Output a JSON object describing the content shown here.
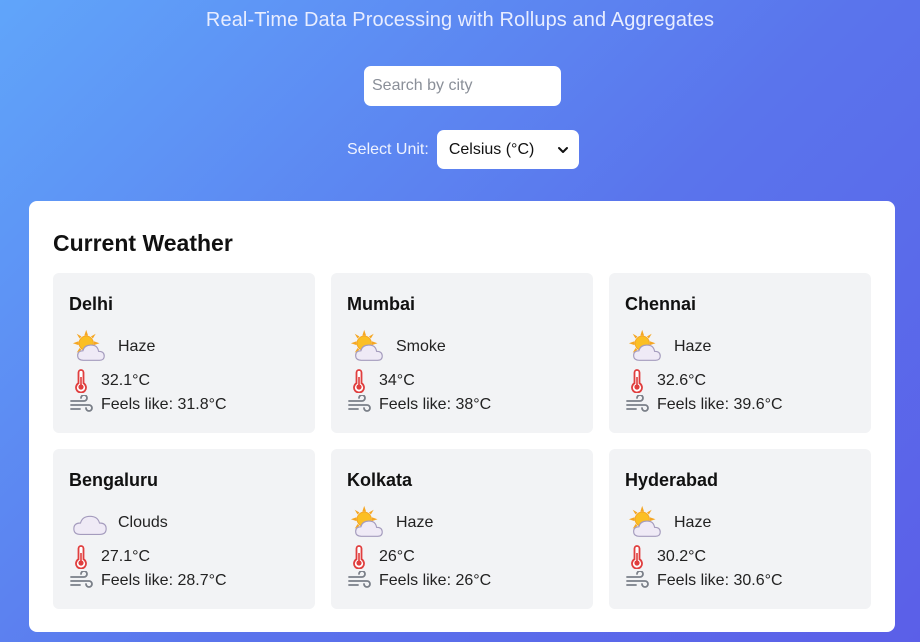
{
  "header": {
    "title": "Real-Time Data Processing with Rollups and Aggregates"
  },
  "search": {
    "placeholder": "Search by city",
    "value": ""
  },
  "unit": {
    "label": "Select Unit:",
    "selected": "Celsius (°C)"
  },
  "panel": {
    "title": "Current Weather"
  },
  "cities": [
    {
      "name": "Delhi",
      "condition": "Haze",
      "icon": "sun-cloud-icon",
      "temp": "32.1°C",
      "feels": "Feels like: 31.8°C"
    },
    {
      "name": "Mumbai",
      "condition": "Smoke",
      "icon": "sun-cloud-icon",
      "temp": "34°C",
      "feels": "Feels like: 38°C"
    },
    {
      "name": "Chennai",
      "condition": "Haze",
      "icon": "sun-cloud-icon",
      "temp": "32.6°C",
      "feels": "Feels like: 39.6°C"
    },
    {
      "name": "Bengaluru",
      "condition": "Clouds",
      "icon": "cloud-icon",
      "temp": "27.1°C",
      "feels": "Feels like: 28.7°C"
    },
    {
      "name": "Kolkata",
      "condition": "Haze",
      "icon": "sun-cloud-icon",
      "temp": "26°C",
      "feels": "Feels like: 26°C"
    },
    {
      "name": "Hyderabad",
      "condition": "Haze",
      "icon": "sun-cloud-icon",
      "temp": "30.2°C",
      "feels": "Feels like: 30.6°C"
    }
  ],
  "colors": {
    "bg_start": "#60a5fa",
    "bg_end": "#5b5fe8",
    "card_bg": "#f2f3f5",
    "thermometer": "#e03e3e",
    "wind": "#7a7f88"
  }
}
